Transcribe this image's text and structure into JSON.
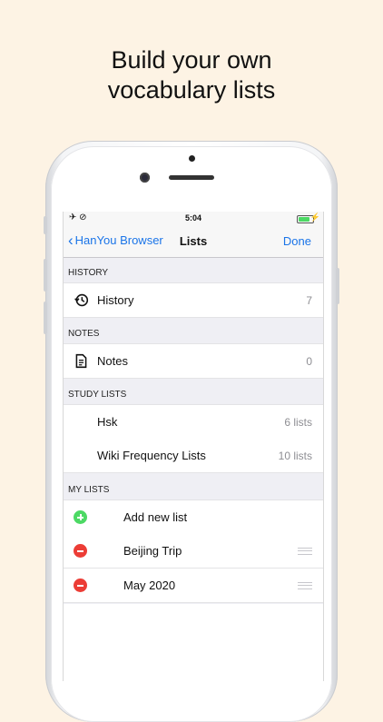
{
  "headline": {
    "line1": "Build your own",
    "line2": "vocabulary lists"
  },
  "status_bar": {
    "time": "5:04"
  },
  "nav": {
    "back_label": "HanYou Browser",
    "title": "Lists",
    "done_label": "Done"
  },
  "sections": {
    "history": {
      "header": "HISTORY",
      "rows": [
        {
          "label": "History",
          "detail": "7",
          "icon": "history-icon"
        }
      ]
    },
    "notes": {
      "header": "NOTES",
      "rows": [
        {
          "label": "Notes",
          "detail": "0",
          "icon": "document-icon"
        }
      ]
    },
    "study_lists": {
      "header": "STUDY LISTS",
      "rows": [
        {
          "label": "Hsk",
          "detail": "6 lists"
        },
        {
          "label": "Wiki Frequency Lists",
          "detail": "10 lists"
        }
      ]
    },
    "my_lists": {
      "header": "MY LISTS",
      "rows": [
        {
          "label": "Add new list",
          "action": "add"
        },
        {
          "label": "Beijing Trip",
          "action": "delete"
        },
        {
          "label": "May 2020",
          "action": "delete"
        }
      ]
    }
  },
  "colors": {
    "accent": "#1a74e8",
    "add": "#4cd964",
    "delete": "#ec3d36",
    "background": "#fdf3e4"
  }
}
